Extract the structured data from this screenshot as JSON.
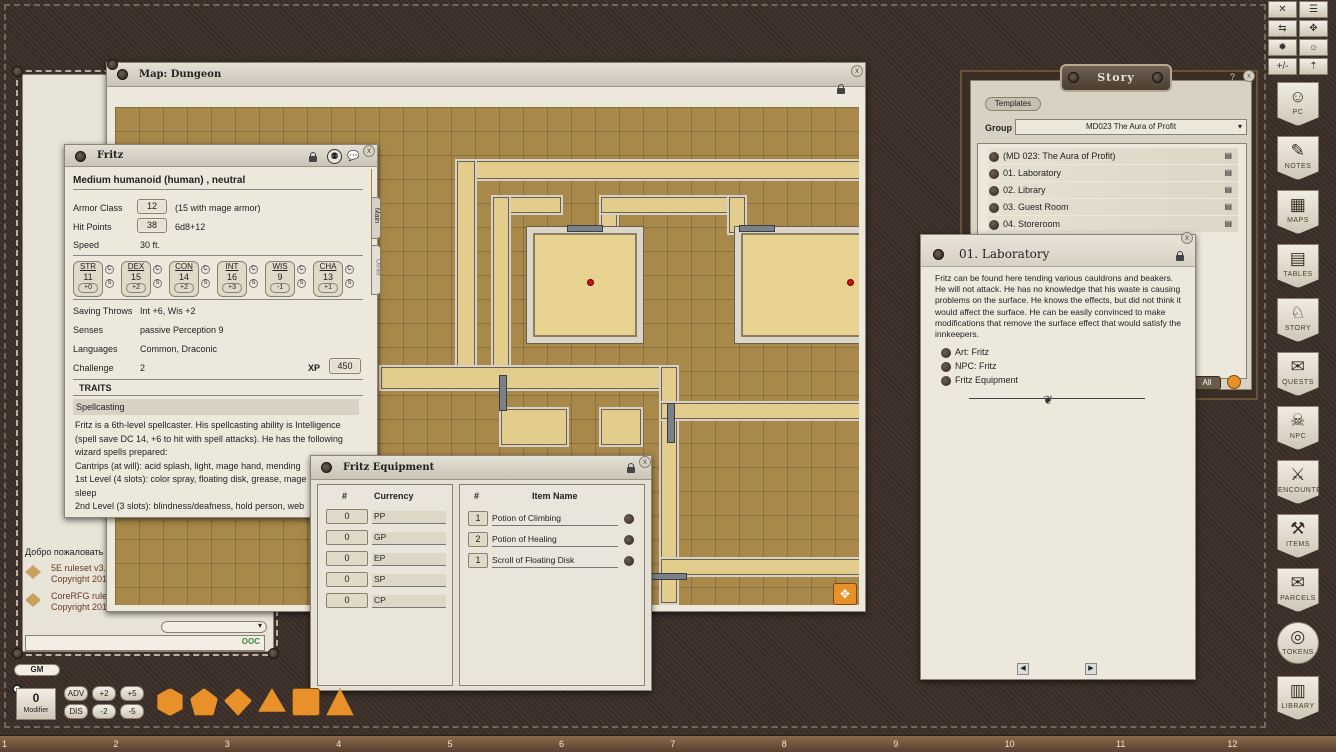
{
  "top_toolbar": {
    "buttons": [
      "✕",
      "☰",
      "⇆",
      "✥",
      "✹",
      "☼",
      "☾",
      "☀",
      "+/-",
      "⇡",
      "⚐"
    ]
  },
  "chat": {
    "welcome": "Добро пожаловать",
    "entries": [
      {
        "title": "5E ruleset v3.",
        "copy": "Copyright 201"
      },
      {
        "title": "CoreRFG rules",
        "copy": "Copyright 201"
      }
    ],
    "ooc_label": "OOC",
    "gm_label": "GM",
    "modifier_value": "0",
    "modifier_label": "Modifier",
    "mod_buttons": [
      "ADV",
      "+2",
      "+5",
      "DIS",
      "-2",
      "-5"
    ]
  },
  "dice": [
    "20",
    "12",
    "10",
    "8",
    "6",
    "4"
  ],
  "map": {
    "title": "Map: Dungeon"
  },
  "npc": {
    "title": "Fritz",
    "subtitle": "Medium humanoid (human) , neutral",
    "armor_class_label": "Armor Class",
    "armor_class": "12",
    "armor_note": "(15 with mage armor)",
    "hp_label": "Hit Points",
    "hp": "38",
    "hp_dice": "6d8+12",
    "speed_label": "Speed",
    "speed": "30 ft.",
    "abilities": [
      {
        "name": "STR",
        "score": "11",
        "mod": "+0"
      },
      {
        "name": "DEX",
        "score": "15",
        "mod": "+2"
      },
      {
        "name": "CON",
        "score": "14",
        "mod": "+2"
      },
      {
        "name": "INT",
        "score": "16",
        "mod": "+3"
      },
      {
        "name": "WIS",
        "score": "9",
        "mod": "-1"
      },
      {
        "name": "CHA",
        "score": "13",
        "mod": "+1"
      }
    ],
    "c_label": "C",
    "s_label": "S",
    "saves_label": "Saving Throws",
    "saves": "Int +6, Wis +2",
    "senses_label": "Senses",
    "senses": "passive Perception 9",
    "languages_label": "Languages",
    "languages": "Common, Draconic",
    "challenge_label": "Challenge",
    "challenge": "2",
    "xp_label": "XP",
    "xp": "450",
    "traits_header": "TRAITS",
    "trait_name": "Spellcasting",
    "trait_text": "Fritz is a 6th-level spellcaster. His spellcasting ability is Intelligence (spell save DC 14, +6 to hit with spell attacks). He has the following wizard spells prepared:",
    "cantrips": "Cantrips (at will): acid splash, light, mage hand, mending",
    "level1": "1st Level (4 slots): color spray, floating disk, grease, mage",
    "level1b": "sleep",
    "level2": "2nd Level (3 slots): blindness/deafness, hold person, web",
    "tabs": [
      "Main",
      "Other"
    ]
  },
  "equipment": {
    "title": "Fritz Equipment",
    "currency_num_header": "#",
    "currency_header": "Currency",
    "item_num_header": "#",
    "item_header": "Item Name",
    "currency": [
      {
        "amount": "0",
        "name": "PP"
      },
      {
        "amount": "0",
        "name": "GP"
      },
      {
        "amount": "0",
        "name": "EP"
      },
      {
        "amount": "0",
        "name": "SP"
      },
      {
        "amount": "0",
        "name": "CP"
      }
    ],
    "items": [
      {
        "count": "1",
        "name": "Potion of Climbing"
      },
      {
        "count": "2",
        "name": "Potion of Healing"
      },
      {
        "count": "1",
        "name": "Scroll of Floating Disk"
      }
    ]
  },
  "story": {
    "title": "Story",
    "templates_label": "Templates",
    "group_label": "Group",
    "group_value": "MD023 The Aura of Profit",
    "help": "?",
    "entries": [
      "(MD 023: The Aura of Profit)",
      "01. Laboratory",
      "02. Library",
      "03. Guest Room",
      "04. Storeroom"
    ],
    "all_label": "All"
  },
  "lab": {
    "title": "01. Laboratory",
    "text": "Fritz can be found here tending various cauldrons and beakers. He will not attack. He has no knowledge that his waste is causing problems on the surface. He knows the effects, but did not think it would affect the surface. He can be easily convinced to make modifications that remove the surface effect that would satisfy the innkeepers.",
    "links": [
      "Art: Fritz",
      "NPC: Fritz",
      "Fritz Equipment"
    ]
  },
  "sidebar": [
    "PC",
    "NOTES",
    "MAPS",
    "TABLES",
    "STORY",
    "QUESTS",
    "NPC",
    "ENCOUNTER",
    "ITEMS",
    "PARCELS",
    "TOKENS",
    "LIBRARY"
  ],
  "ruler": [
    "1",
    "2",
    "3",
    "4",
    "5",
    "6",
    "7",
    "8",
    "9",
    "10",
    "11",
    "12"
  ],
  "colors": {
    "leather": "#3d3129",
    "parchment": "#ece8dc",
    "accent": "#e8912a"
  }
}
